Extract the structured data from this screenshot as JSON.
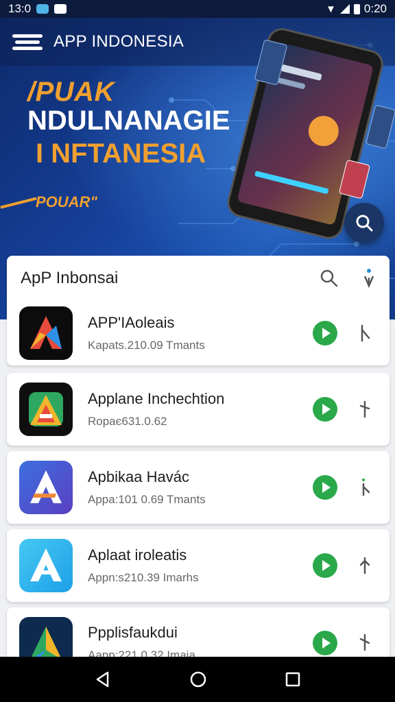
{
  "status_bar": {
    "time_left": "13:0",
    "time_right": "0:20"
  },
  "app_bar": {
    "title": "APP INDONESIA"
  },
  "hero": {
    "line1": "/PUAK",
    "line2": "NDULNANAGIE",
    "line3": "I NFTANESIA",
    "tag": "POUAR\""
  },
  "list_header": {
    "title": "ApP Inbonsai"
  },
  "apps": [
    {
      "name": "APP'IAoleais",
      "meta": "Kapats.210.09  Tmants",
      "icon": "app-icon-a-dark"
    },
    {
      "name": "Applane Inchechtion",
      "meta": "Ropaє631.0.62",
      "icon": "app-icon-a-green"
    },
    {
      "name": "Apbikaa Havác",
      "meta": "Appa:101 0.69  Tmants",
      "icon": "app-icon-a-indigo"
    },
    {
      "name": "Aplaat iroleatis",
      "meta": "Appn:s210.39  Imarhs",
      "icon": "app-icon-a-lightblue"
    },
    {
      "name": "Ppplisfaukdui",
      "meta": "Aapp:221 0.32  Imaia",
      "icon": "app-icon-a-navy"
    }
  ],
  "colors": {
    "accent_green": "#2aa84a",
    "hero_orange": "#f0a030",
    "hero_blue": "#16409a"
  }
}
